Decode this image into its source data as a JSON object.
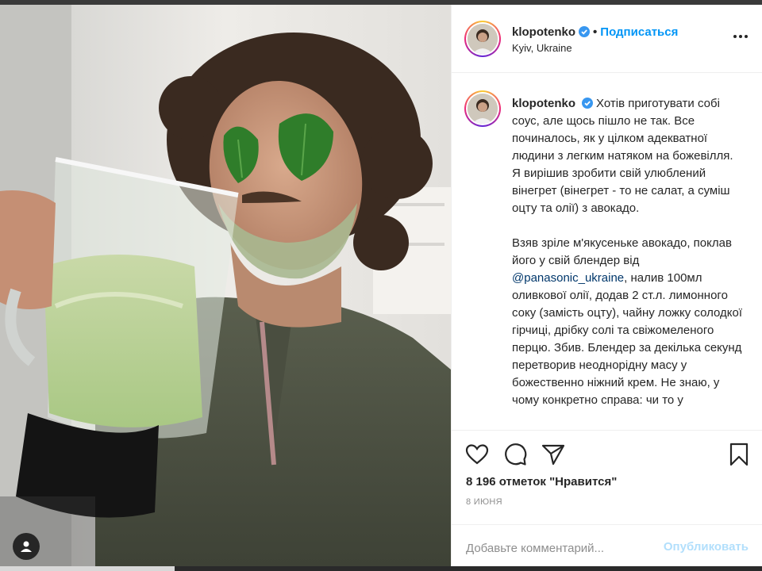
{
  "post": {
    "username": "klopotenko",
    "follow_label": "Подписаться",
    "location": "Kyiv, Ukraine",
    "caption_paragraphs": [
      "Хотів приготувати собі соус, але щось пішло не так. Все починалось, як у цілком адекватної людини з легким натяком на божевілля. Я вирішив зробити свій улюблений вінегрет (вінегрет - то не салат, а суміш оцту та олії) з авокадо."
    ],
    "caption_p2_before": "Взяв зріле м'якусеньке авокадо, поклав його у свій блендер від ",
    "caption_mention": "@panasonic_ukraine",
    "caption_p2_after": ", налив 100мл оливкової олії, додав 2 ст.л. лимонного соку (замість оцту), чайну ложку солодкої гірчиці, дрібку солі та свіжомеленого перцю. Збив. Блендер за декілька секунд перетворив неоднорідну масу у божественно ніжний крем. Не знаю, у чому конкретно справа: чи то у",
    "likes_text": "8 196 отметок \"Нравится\"",
    "date_text": "8 ИЮНЯ",
    "comment_placeholder": "Добавьте комментарий...",
    "publish_label": "Опубликовать"
  },
  "icons": [
    "verified-badge-icon",
    "more-options-icon",
    "heart-icon",
    "comment-icon",
    "share-icon",
    "bookmark-icon",
    "user-tag-icon"
  ],
  "colors": {
    "link": "#0095f6",
    "mention": "#00376b",
    "publish_disabled": "#b2dffc",
    "muted": "#8e8e8e"
  }
}
